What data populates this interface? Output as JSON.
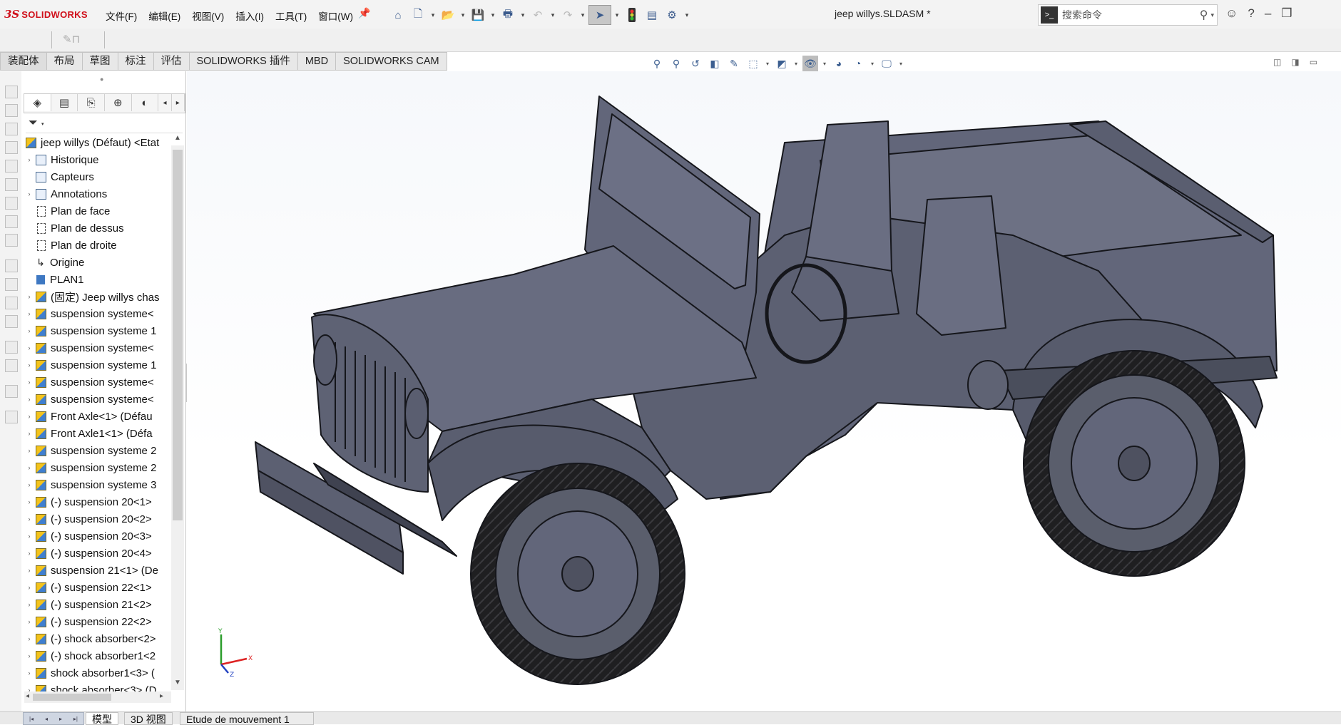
{
  "app": {
    "brand_mark": "3S",
    "brand_name": "SOLIDWORKS",
    "document_title": "jeep willys.SLDASM *"
  },
  "menu": [
    "文件(F)",
    "编辑(E)",
    "视图(V)",
    "插入(I)",
    "工具(T)",
    "窗口(W)"
  ],
  "search": {
    "placeholder": "搜索命令"
  },
  "command_tabs": [
    "装配体",
    "布局",
    "草图",
    "标注",
    "评估",
    "SOLIDWORKS 插件",
    "MBD",
    "SOLIDWORKS CAM"
  ],
  "tree": {
    "root": "jeep willys (Défaut) <Etat",
    "items": [
      {
        "label": "Historique",
        "icon": "history-icon",
        "expand": true
      },
      {
        "label": "Capteurs",
        "icon": "sensor-icon",
        "expand": false
      },
      {
        "label": "Annotations",
        "icon": "annotation-icon",
        "expand": true
      },
      {
        "label": "Plan de face",
        "icon": "plane-icon",
        "expand": false
      },
      {
        "label": "Plan de dessus",
        "icon": "plane-icon",
        "expand": false
      },
      {
        "label": "Plan de droite",
        "icon": "plane-icon",
        "expand": false
      },
      {
        "label": "Origine",
        "icon": "origin-icon",
        "expand": false
      },
      {
        "label": "PLAN1",
        "icon": "plan1-icon",
        "expand": false
      },
      {
        "label": "(固定) Jeep willys chas",
        "icon": "part-icon",
        "expand": true
      },
      {
        "label": "suspension systeme<",
        "icon": "part-icon",
        "expand": true
      },
      {
        "label": "suspension systeme 1",
        "icon": "part-icon",
        "expand": true
      },
      {
        "label": "suspension systeme<",
        "icon": "part-icon",
        "expand": true
      },
      {
        "label": "suspension systeme 1",
        "icon": "part-icon",
        "expand": true
      },
      {
        "label": "suspension systeme<",
        "icon": "part-icon",
        "expand": true
      },
      {
        "label": "suspension systeme<",
        "icon": "part-icon",
        "expand": true
      },
      {
        "label": "Front Axle<1> (Défau",
        "icon": "part-icon",
        "expand": true
      },
      {
        "label": "Front Axle1<1> (Défa",
        "icon": "part-icon",
        "expand": true
      },
      {
        "label": "suspension systeme 2",
        "icon": "part-icon",
        "expand": true
      },
      {
        "label": "suspension systeme 2",
        "icon": "part-icon",
        "expand": true
      },
      {
        "label": "suspension systeme 3",
        "icon": "part-icon",
        "expand": true
      },
      {
        "label": "(-) suspension 20<1>",
        "icon": "part-icon",
        "expand": true
      },
      {
        "label": "(-) suspension 20<2>",
        "icon": "part-icon",
        "expand": true
      },
      {
        "label": "(-) suspension 20<3>",
        "icon": "part-icon",
        "expand": true
      },
      {
        "label": "(-) suspension 20<4>",
        "icon": "part-icon",
        "expand": true
      },
      {
        "label": "suspension 21<1> (De",
        "icon": "part-icon",
        "expand": true
      },
      {
        "label": "(-) suspension 22<1>",
        "icon": "part-icon",
        "expand": true
      },
      {
        "label": "(-) suspension 21<2>",
        "icon": "part-icon",
        "expand": true
      },
      {
        "label": "(-) suspension 22<2>",
        "icon": "part-icon",
        "expand": true
      },
      {
        "label": "(-) shock absorber<2>",
        "icon": "part-icon",
        "expand": true
      },
      {
        "label": "(-) shock absorber1<2",
        "icon": "part-icon",
        "expand": true
      },
      {
        "label": "shock absorber1<3> (",
        "icon": "part-icon",
        "expand": true
      },
      {
        "label": "shock absorber<3> (D",
        "icon": "part-icon",
        "expand": true
      }
    ]
  },
  "bottom_tabs": [
    "模型",
    "3D 视图",
    "Etude de mouvement 1"
  ],
  "triad": {
    "x": "X",
    "y": "Y",
    "z": "Z"
  },
  "colors": {
    "brand": "#d0101b",
    "model_body": "#646878",
    "tire": "#1e1e20",
    "wheel": "#5a5e6c"
  }
}
